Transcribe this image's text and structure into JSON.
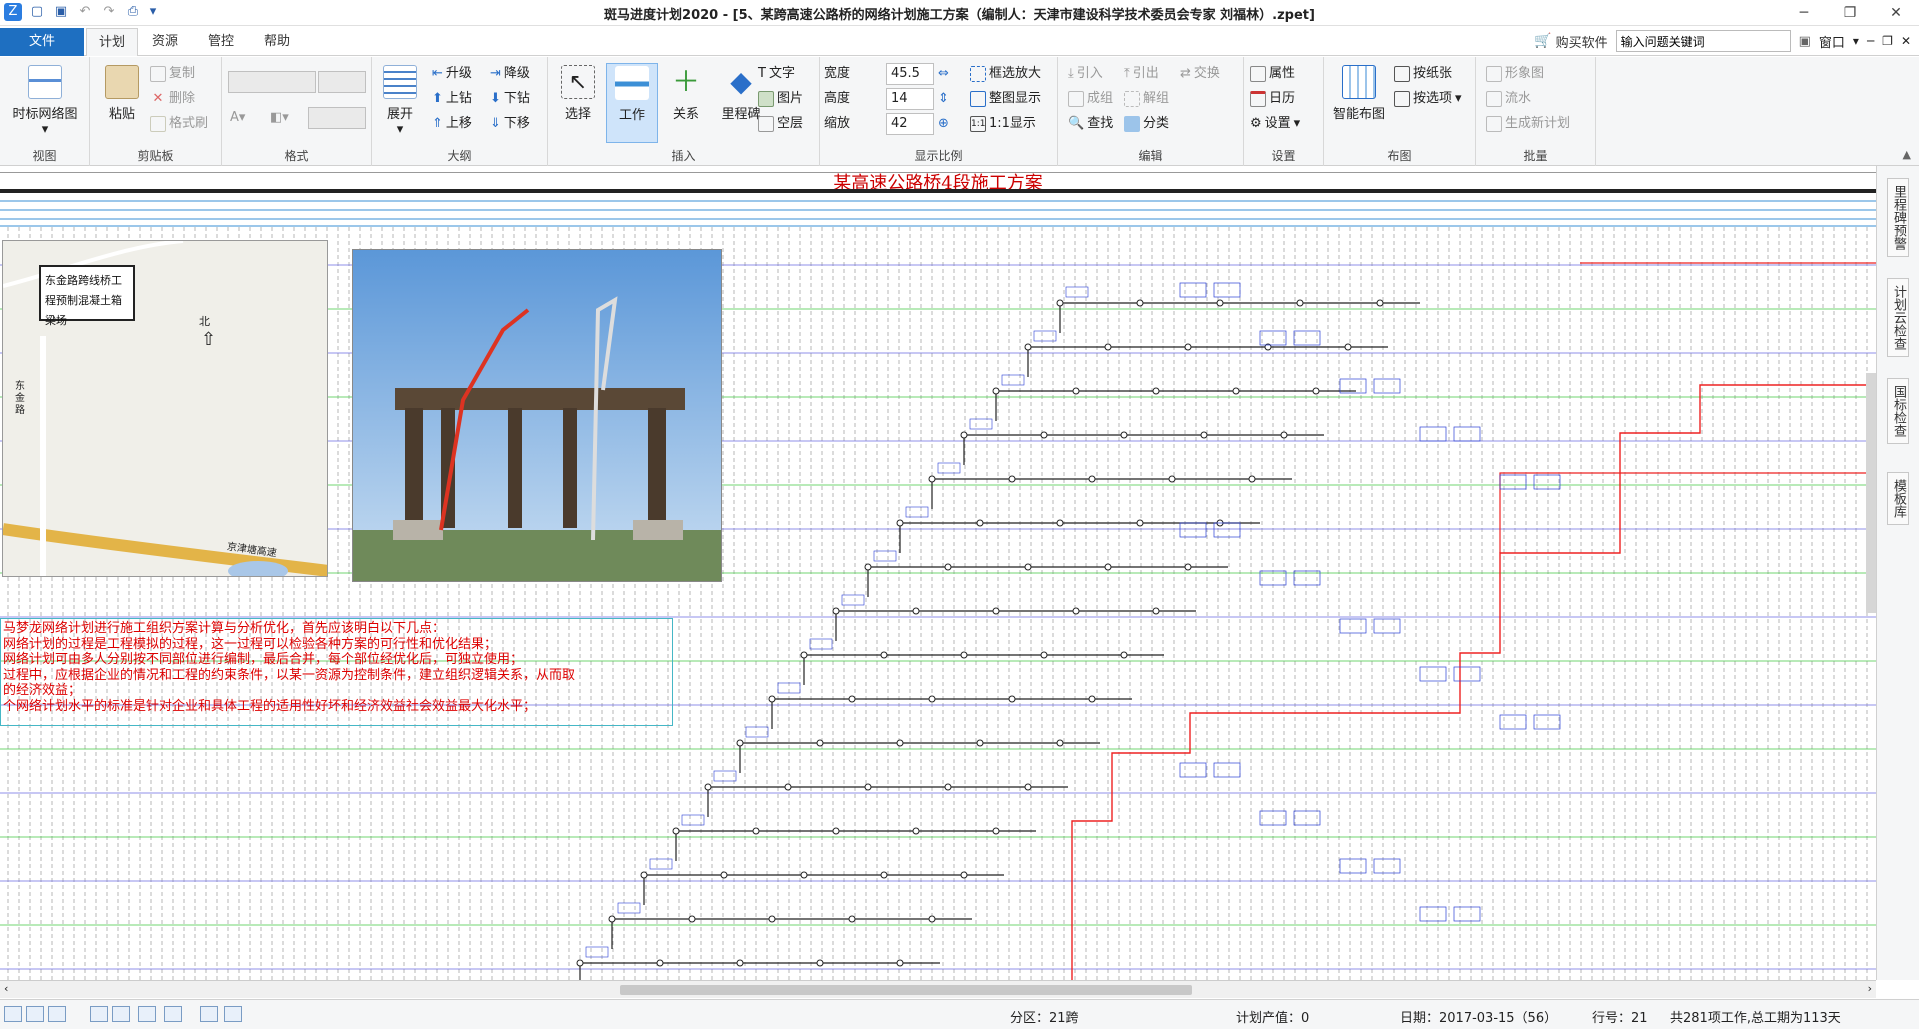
{
  "window": {
    "title": "斑马进度计划2020 - [5、某跨高速公路桥的网络计划施工方案（编制人：天津市建设科学技术委员会专家 刘福林）.zpet]",
    "controls": [
      "minimize-icon",
      "restore-icon",
      "close-icon"
    ]
  },
  "tabs": {
    "file": "文件",
    "items": [
      "计划",
      "资源",
      "管控",
      "帮助"
    ],
    "active": "计划",
    "buy": "购买软件",
    "search_value": "输入问题关键词",
    "window_menu": "窗口"
  },
  "ribbon": {
    "view": {
      "label": "视图",
      "timescale": "时标网络图"
    },
    "clipboard": {
      "label": "剪贴板",
      "paste": "粘贴",
      "copy": "复制",
      "delete": "删除",
      "format_painter": "格式刷"
    },
    "format": {
      "label": "格式"
    },
    "outline": {
      "label": "大纲",
      "expand": "展开",
      "promote": "升级",
      "demote": "降级",
      "move_up": "上钻",
      "move_down": "下钻",
      "shift_up": "上移",
      "shift_down": "下移"
    },
    "insert": {
      "label": "插入",
      "select": "选择",
      "work": "工作",
      "relation": "关系",
      "milestone": "里程碑",
      "text": "文字",
      "image": "图片",
      "blank": "空层"
    },
    "scale": {
      "label": "显示比例",
      "width_label": "宽度",
      "width": "45.5",
      "height_label": "高度",
      "height": "14",
      "zoom_label": "缩放",
      "zoom": "42",
      "box_zoom": "框选放大",
      "fit": "整图显示",
      "one_to_one": "1:1显示"
    },
    "edit": {
      "label": "编辑",
      "lead_in": "引入",
      "lead_out": "引出",
      "swap": "交换",
      "group": "成组",
      "ungroup": "解组",
      "find": "查找",
      "classify": "分类"
    },
    "settings": {
      "label": "设置",
      "properties": "属性",
      "calendar": "日历",
      "settings": "设置"
    },
    "layout": {
      "label": "布图",
      "smart": "智能布图",
      "by_paper": "按纸张",
      "by_option": "按选项"
    },
    "batch": {
      "label": "批量",
      "image_chart": "形象图",
      "flow": "流水",
      "new_plan": "生成新计划"
    }
  },
  "canvas": {
    "plan_title": "某高速公路桥4段施工方案",
    "map": {
      "site_label": "东金路跨线桥工程预制混凝土箱梁场",
      "north": "北",
      "road_1": "东金路",
      "road_2": "京津塘高速"
    },
    "note_lines": [
      "马梦龙网络计划进行施工组织方案计算与分析优化，首先应该明白以下几点：",
      "网络计划的过程是工程模拟的过程，这一过程可以检验各种方案的可行性和优化结果；",
      "网络计划可由多人分别按不同部位进行编制，最后合并，每个部位经优化后，可独立使用；",
      "过程中，应根据企业的情况和工程的约束条件，以某一资源为控制条件，建立组织逻辑关系，从而取",
      "的经济效益；",
      "个网络计划水平的标准是针对企业和具体工程的适用性好坏和经济效益社会效益最大化水平；"
    ]
  },
  "sidebar": {
    "items": [
      "里程碑预警",
      "计划云检查",
      "国标检查",
      "模板库"
    ]
  },
  "status": {
    "zones": "分区：21跨",
    "output": "计划产值：0",
    "date": "日期：2017-03-15（56）",
    "row": "行号：21",
    "summary": "共281项工作,总工期为113天"
  }
}
